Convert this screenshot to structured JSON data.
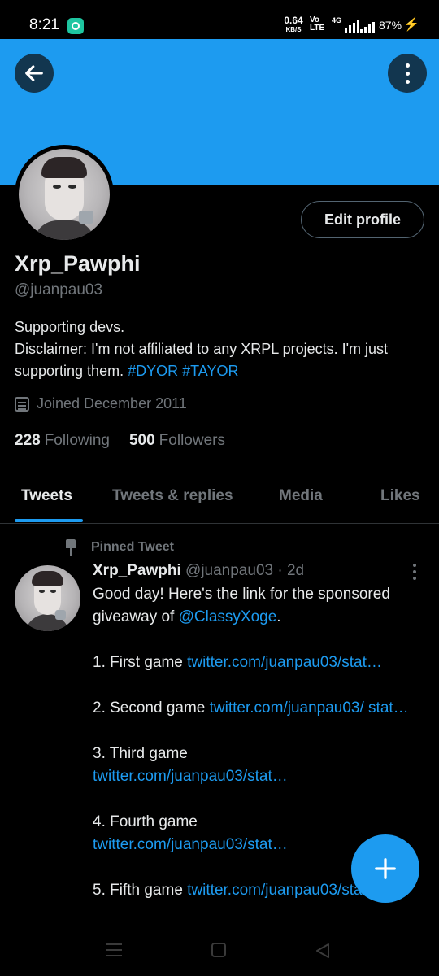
{
  "status_bar": {
    "time": "8:21",
    "net_speed": "0.64",
    "net_unit": "KB/S",
    "volte": "Vo LTE",
    "network_type": "4G",
    "battery": "87%"
  },
  "profile": {
    "edit_label": "Edit profile",
    "name": "Xrp_Pawphi",
    "handle": "@juanpau03",
    "bio_line1": "Supporting devs.",
    "bio_line2": "Disclaimer: I'm not affiliated to any XRPL projects. I'm just supporting them.",
    "bio_tag1": "#DYOR",
    "bio_tag2": "#TAYOR",
    "joined": "Joined December 2011",
    "following_count": "228",
    "following_label": "Following",
    "followers_count": "500",
    "followers_label": "Followers"
  },
  "tabs": [
    {
      "label": "Tweets",
      "active": true
    },
    {
      "label": "Tweets & replies",
      "active": false
    },
    {
      "label": "Media",
      "active": false
    },
    {
      "label": "Likes",
      "active": false
    }
  ],
  "tweet": {
    "pinned_label": "Pinned Tweet",
    "author": "Xrp_Pawphi",
    "handle": "@juanpau03",
    "separator": "·",
    "time": "2d",
    "intro": "Good day! Here's the link for the sponsored giveaway of",
    "mention": "@ClassyXoge",
    "intro_end": ".",
    "items": [
      {
        "label": "1. First game",
        "link": "twitter.com/juanpau03/stat…"
      },
      {
        "label": "2. Second game",
        "link": "twitter.com/juanpau03/ stat…"
      },
      {
        "label": "3. Third game",
        "link": "twitter.com/juanpau03/stat…"
      },
      {
        "label": "4. Fourth game",
        "link": "twitter.com/juanpau03/stat…"
      },
      {
        "label": "5. Fifth game",
        "link": "twitter.com/juanpau03/stat…"
      }
    ]
  },
  "icons": {
    "back": "arrow-left-icon",
    "more": "more-vertical-icon",
    "calendar": "calendar-icon",
    "pin": "pin-icon",
    "compose": "plus-icon"
  },
  "colors": {
    "accent": "#1d9bf0",
    "background": "#000000",
    "text": "#e7e9ea",
    "muted": "#71767b"
  }
}
